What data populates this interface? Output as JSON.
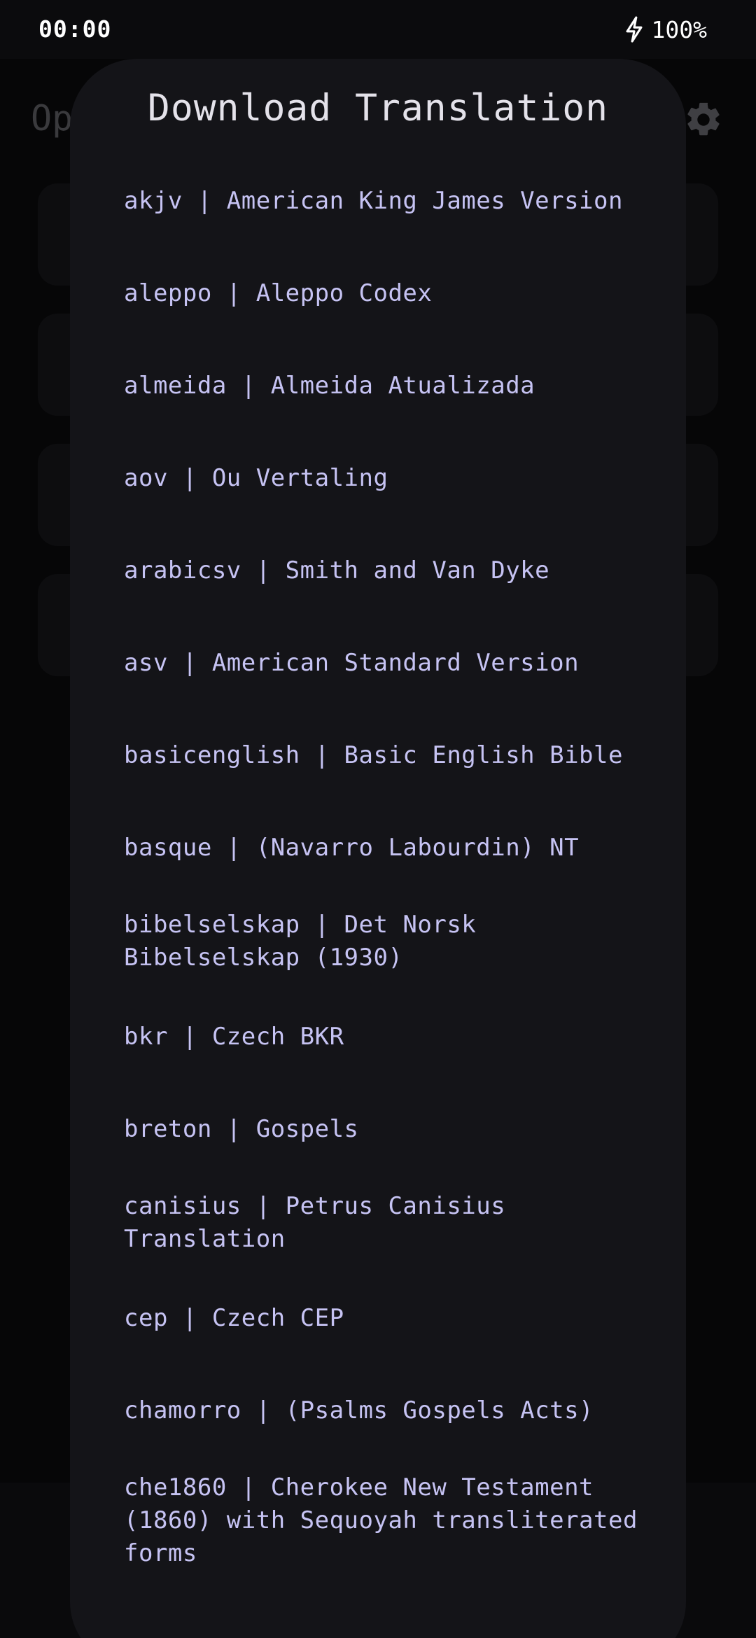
{
  "status_bar": {
    "time": "00:00",
    "battery": "100%",
    "battery_icon": "charging-bolt-icon"
  },
  "background_app": {
    "title_partial": "Op",
    "settings_icon": "gear-icon"
  },
  "dialog": {
    "title": "Download Translation",
    "items": [
      {
        "label": "akjv | American King James Version"
      },
      {
        "label": "aleppo | Aleppo Codex"
      },
      {
        "label": "almeida | Almeida Atualizada"
      },
      {
        "label": "aov | Ou Vertaling"
      },
      {
        "label": "arabicsv | Smith and Van Dyke"
      },
      {
        "label": "asv | American Standard Version"
      },
      {
        "label": "basicenglish | Basic English Bible"
      },
      {
        "label": "basque | (Navarro Labourdin) NT"
      },
      {
        "label": "bibelselskap | Det Norsk Bibelselskap (1930)"
      },
      {
        "label": "bkr | Czech BKR"
      },
      {
        "label": "breton | Gospels"
      },
      {
        "label": "canisius | Petrus Canisius Translation"
      },
      {
        "label": "cep | Czech CEP"
      },
      {
        "label": "chamorro | (Psalms Gospels Acts)"
      },
      {
        "label": "che1860 | Cherokee New Testament (1860) with Sequoyah transliterated forms"
      }
    ]
  }
}
